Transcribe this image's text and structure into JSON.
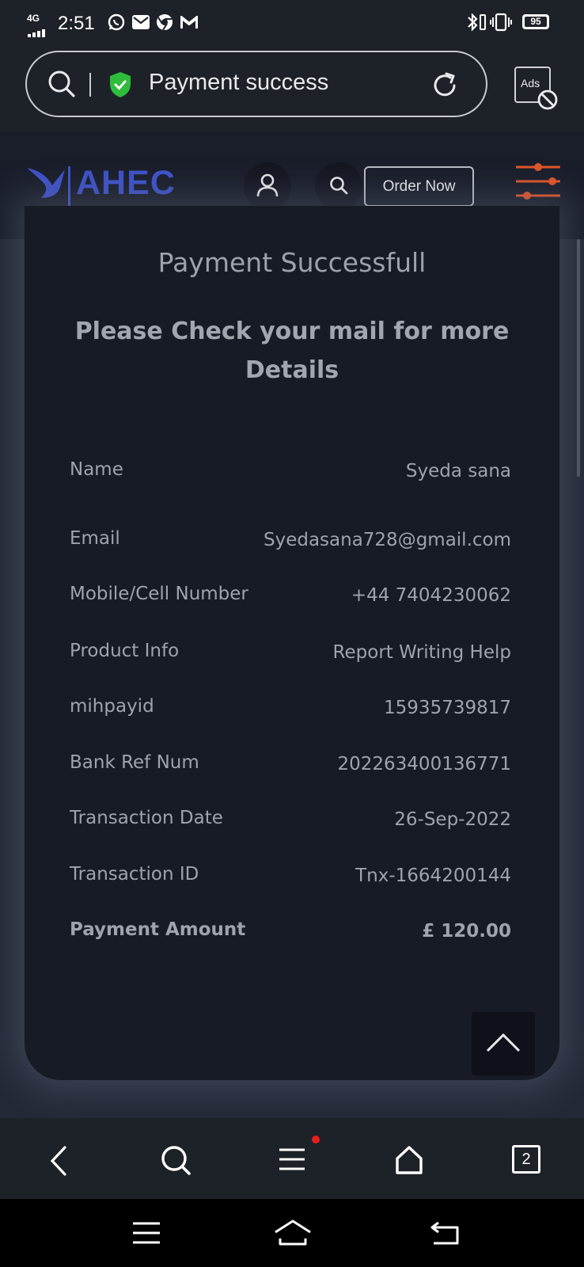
{
  "status_bar": {
    "network": "4G",
    "time": "2:51",
    "battery": "95"
  },
  "browser": {
    "url_title": "Payment success",
    "ads_label": "Ads"
  },
  "header": {
    "logo": "AHEC",
    "order_button": "Order Now"
  },
  "card": {
    "title": "Payment Successfull",
    "subtitle": "Please Check your mail for more Details",
    "rows": [
      {
        "label": "Name",
        "value": "Syeda sana"
      },
      {
        "label": "Email",
        "value": "Syedasana728@gmail.com"
      },
      {
        "label": "Mobile/Cell Number",
        "value": "+44 7404230062"
      },
      {
        "label": "Product Info",
        "value": "Report Writing Help"
      },
      {
        "label": "mihpayid",
        "value": "15935739817"
      },
      {
        "label": "Bank Ref Num",
        "value": "202263400136771"
      },
      {
        "label": "Transaction Date",
        "value": "26-Sep-2022"
      },
      {
        "label": "Transaction ID",
        "value": "Tnx-1664200144"
      },
      {
        "label": "Payment Amount",
        "value": "£ 120.00"
      }
    ]
  },
  "bottom_nav": {
    "tab_count": "2"
  },
  "colors": {
    "brand": "#3e52c8",
    "accent_orange": "#e0552a",
    "shield_green": "#2ebd3a"
  }
}
